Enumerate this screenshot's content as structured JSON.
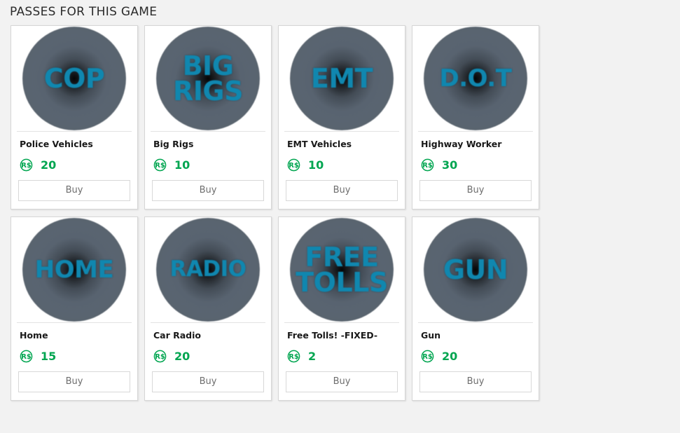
{
  "page": {
    "heading": "PASSES FOR THIS GAME",
    "background_color": "#f2f2f2"
  },
  "colors": {
    "accent_cyan": "#1087af",
    "robux_green": "#00a550",
    "card_border": "#d6d6d6",
    "heading_text": "#2b2b2b",
    "button_text": "#6e6e6e"
  },
  "icons": {
    "robux": "robux-icon"
  },
  "buy_label": "Buy",
  "passes": [
    {
      "thumb_text": "COP",
      "thumb_size": "size-lg",
      "name": "Police Vehicles",
      "price": "20"
    },
    {
      "thumb_text": "BIG\nRIGS",
      "thumb_size": "size-lg",
      "name": "Big Rigs",
      "price": "10"
    },
    {
      "thumb_text": "EMT",
      "thumb_size": "size-lg",
      "name": "EMT Vehicles",
      "price": "10"
    },
    {
      "thumb_text": "D.O.T",
      "thumb_size": "size-sm",
      "name": "Highway Worker",
      "price": "30"
    },
    {
      "thumb_text": "HOME",
      "thumb_size": "size-sm",
      "name": "Home",
      "price": "15"
    },
    {
      "thumb_text": "RADIO",
      "thumb_size": "size-xs",
      "name": "Car Radio",
      "price": "20"
    },
    {
      "thumb_text": "FREE\nTOLLS",
      "thumb_size": "size-lg",
      "name": "Free Tolls! -FIXED-",
      "price": "2"
    },
    {
      "thumb_text": "GUN",
      "thumb_size": "size-lg",
      "name": "Gun",
      "price": "20"
    }
  ]
}
